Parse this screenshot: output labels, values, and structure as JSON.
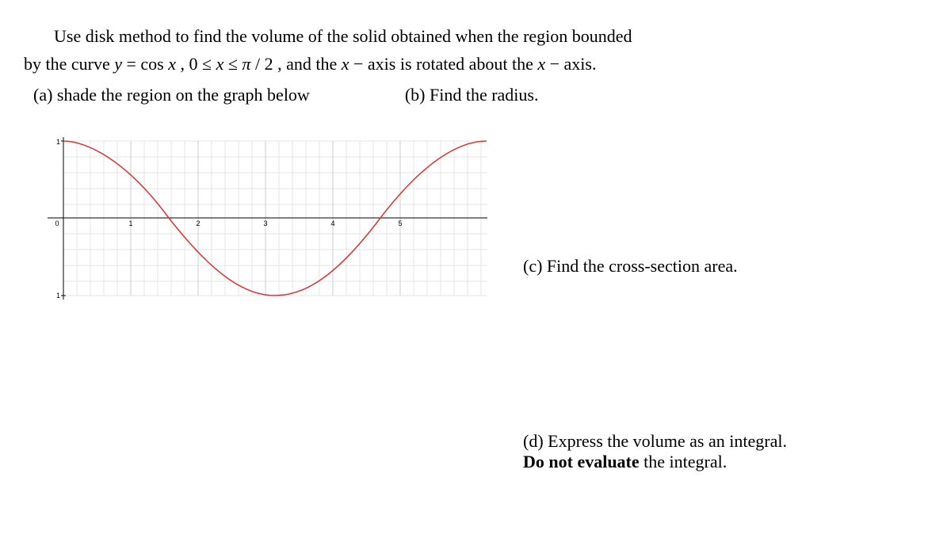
{
  "problem": {
    "intro_line1_prefix": "Use disk method to find the volume of the solid obtained when the region bounded",
    "intro_line2_prefix": "by the curve  ",
    "equation_y": "y",
    "equation_eq": " = cos ",
    "equation_x": "x",
    "equation_range_prefix": " ,  0 ≤ ",
    "equation_range_x": "x",
    "equation_range_leq": " ≤ ",
    "equation_pi": "π",
    "equation_over2": " / 2",
    "intro_line2_mid": " , and the  ",
    "axis_x1": "x",
    "axis_dash1": " − axis is rotated about the  ",
    "axis_x2": "x",
    "axis_dash2": " − axis."
  },
  "parts": {
    "a": "(a) shade the region on the graph below",
    "b": "(b) Find the radius.",
    "c": "(c) Find the cross-section area.",
    "d_prefix": "(d) Express the volume as an integral.",
    "d_bold": "Do not  evaluate",
    "d_suffix": " the integral."
  },
  "chart_data": {
    "type": "line",
    "title": "",
    "xlabel": "",
    "ylabel": "",
    "xlim": [
      0,
      6.3
    ],
    "ylim": [
      -1,
      1
    ],
    "x_ticks": [
      0,
      1,
      2,
      3,
      4,
      5
    ],
    "y_ticks": [
      -1,
      1
    ],
    "series": [
      {
        "name": "y = cos x",
        "x": [
          0,
          0.3,
          0.6,
          0.9,
          1.2,
          1.5,
          1.57,
          1.8,
          2.1,
          2.4,
          2.7,
          3.0,
          3.14,
          3.3,
          3.6,
          3.9,
          4.2,
          4.5,
          4.71,
          4.8,
          5.1,
          5.4,
          5.7,
          6.0,
          6.28
        ],
        "y": [
          1,
          0.955,
          0.825,
          0.622,
          0.362,
          0.071,
          0,
          -0.227,
          -0.505,
          -0.737,
          -0.904,
          -0.99,
          -1,
          -0.987,
          -0.896,
          -0.726,
          -0.49,
          -0.211,
          0,
          0.087,
          0.378,
          0.635,
          0.834,
          0.96,
          1
        ]
      }
    ]
  }
}
